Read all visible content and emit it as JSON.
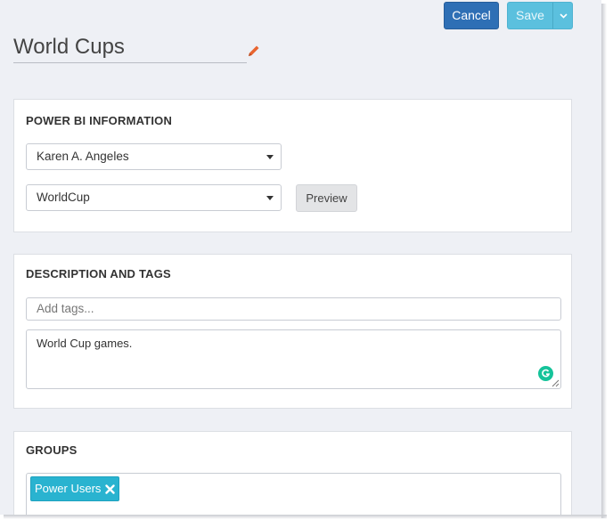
{
  "header": {
    "cancel_label": "Cancel",
    "save_label": "Save",
    "title": "World Cups"
  },
  "powerbi": {
    "heading": "POWER BI INFORMATION",
    "user_select": "Karen A. Angeles",
    "report_select": "WorldCup",
    "preview_label": "Preview"
  },
  "description": {
    "heading": "DESCRIPTION AND TAGS",
    "tags_placeholder": "Add tags...",
    "text": "World Cup games."
  },
  "groups": {
    "heading": "GROUPS",
    "chips": [
      {
        "label": "Power Users"
      }
    ]
  },
  "colors": {
    "background": "#eef0f5",
    "cancel": "#2e6fb5",
    "save": "#5bc0de",
    "chip": "#29b3d0",
    "edit_icon": "#e8652f",
    "grammarly": "#15c39a"
  },
  "icons": [
    "pencil-icon",
    "chevron-down-icon",
    "caret-down-icon",
    "grammarly-icon",
    "close-icon",
    "resize-grip-icon"
  ]
}
